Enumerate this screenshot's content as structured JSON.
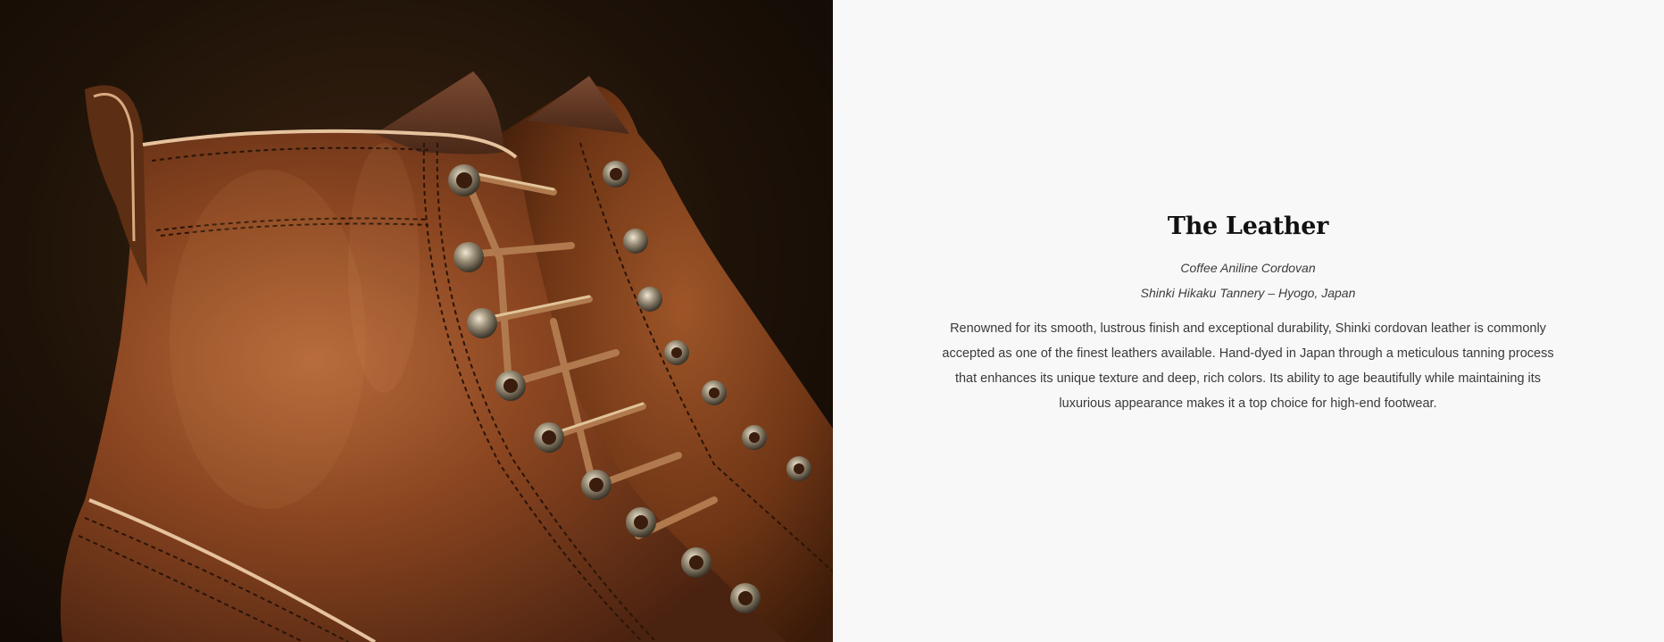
{
  "photo": {
    "subject": "boot-photo"
  },
  "leather_section": {
    "title": "The Leather",
    "material": "Coffee Aniline Cordovan",
    "tannery": "Shinki Hikaku Tannery – Hyogo, Japan",
    "description": "Renowned for its smooth, lustrous finish and exceptional durability, Shinki cordovan leather is commonly accepted as one of the finest leathers available. Hand-dyed in Japan through a meticulous tanning process that enhances its unique texture and deep, rich colors. Its ability to age beautifully while maintaining its luxurious appearance makes it a top choice for high-end footwear."
  },
  "colors": {
    "text_background": "#f8f8f8",
    "title": "#111111",
    "body": "#3a3a3a",
    "leather": "#7a3f1c"
  }
}
